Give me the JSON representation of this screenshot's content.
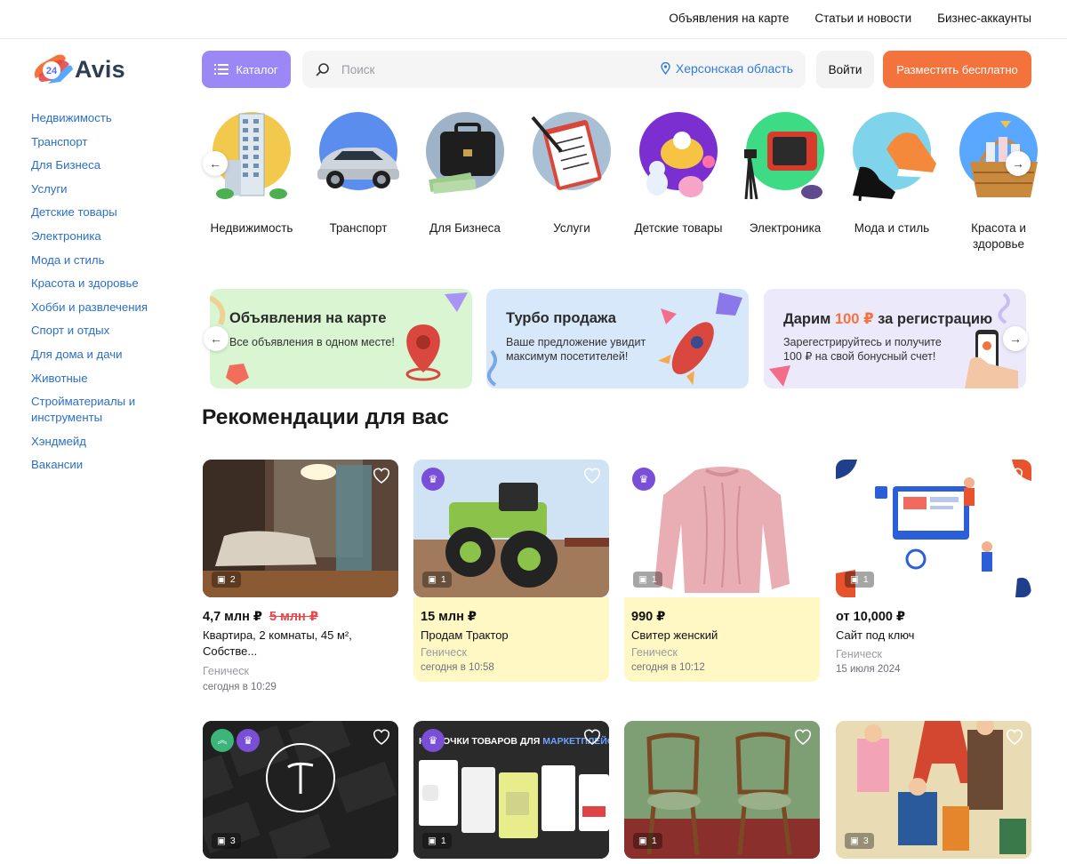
{
  "top_links": [
    "Объявления на карте",
    "Статьи и новости",
    "Бизнес-аккаунты"
  ],
  "logo": {
    "badge": "24",
    "text": "Avis"
  },
  "header": {
    "catalog_label": "Каталог",
    "search_placeholder": "Поиск",
    "region": "Херсонская область",
    "login_label": "Войти",
    "post_label": "Разместить бесплатно"
  },
  "sidebar": [
    "Недвижимость",
    "Транспорт",
    "Для Бизнеса",
    "Услуги",
    "Детские товары",
    "Электроника",
    "Мода и стиль",
    "Красота и здоровье",
    "Хобби и развлечения",
    "Спорт и отдых",
    "Для дома и дачи",
    "Животные",
    "Стройматериалы и инструменты",
    "Хэндмейд",
    "Вакансии"
  ],
  "categories": [
    {
      "label": "Недвижимость",
      "icon": "building-icon",
      "bg": "#f2c94c"
    },
    {
      "label": "Транспорт",
      "icon": "car-icon",
      "bg": "#5b8def"
    },
    {
      "label": "Для Бизнеса",
      "icon": "briefcase-icon",
      "bg": "#9fb3c8"
    },
    {
      "label": "Услуги",
      "icon": "clipboard-icon",
      "bg": "#a9bfd4"
    },
    {
      "label": "Детские товары",
      "icon": "toys-icon",
      "bg": "#7b2fd0"
    },
    {
      "label": "Электроника",
      "icon": "tv-icon",
      "bg": "#3ddc84"
    },
    {
      "label": "Мода и стиль",
      "icon": "shoes-icon",
      "bg": "#7fd3ea"
    },
    {
      "label": "Красота и здоровье",
      "icon": "basket-icon",
      "bg": "#5aa7ff"
    }
  ],
  "promos": [
    {
      "title": "Объявления на карте",
      "desc": "Все объявления в одном месте!",
      "bg": "#d9f5d2"
    },
    {
      "title": "Турбо продажа",
      "desc": "Ваше предложение увидит максимум посетителей!",
      "bg": "#d8e8fb"
    },
    {
      "title_before": "Дарим ",
      "title_accent": "100 ₽",
      "title_after": " за регистрацию",
      "desc": "Зарегестрируйтесь и получите 100 ₽ на свой бонусный счет!",
      "bg": "#ece9fb"
    }
  ],
  "section_title": "Рекомендации для вас",
  "listings": [
    {
      "price": "4,7 млн ₽",
      "old_price": "5 млн ₽",
      "title": "Квартира, 2 комнаты, 45 м², Собстве...",
      "city": "Геническ",
      "date": "сегодня в 10:29",
      "photos": "2",
      "highlight": false,
      "badge": "",
      "photo_desc": "bedroom"
    },
    {
      "price": "15 млн ₽",
      "old_price": "",
      "title": "Продам Трактор",
      "city": "Геническ",
      "date": "сегодня в 10:58",
      "photos": "1",
      "highlight": true,
      "badge": "crown",
      "photo_desc": "tractor"
    },
    {
      "price": "990 ₽",
      "old_price": "",
      "title": "Свитер женский",
      "city": "Геническ",
      "date": "сегодня в 10:12",
      "photos": "1",
      "highlight": true,
      "badge": "crown",
      "photo_desc": "sweater"
    },
    {
      "price": "от 10,000 ₽",
      "old_price": "",
      "title": "Сайт под ключ",
      "city": "Геническ",
      "date": "15 июля 2024",
      "photos": "1",
      "highlight": false,
      "badge": "",
      "photo_desc": "website"
    },
    {
      "photos": "3",
      "badge": "up-crown",
      "photo_desc": "tilda"
    },
    {
      "photos": "1",
      "badge": "crown",
      "photo_desc": "cards",
      "photo_caption_a": "КАРТОЧКИ ТОВАРОВ ДЛЯ ",
      "photo_caption_b": "МАРКЕТПЛЕЙСОВ"
    },
    {
      "photos": "1",
      "badge": "",
      "photo_desc": "chairs"
    },
    {
      "photos": "3",
      "badge": "",
      "photo_desc": "poster"
    }
  ]
}
